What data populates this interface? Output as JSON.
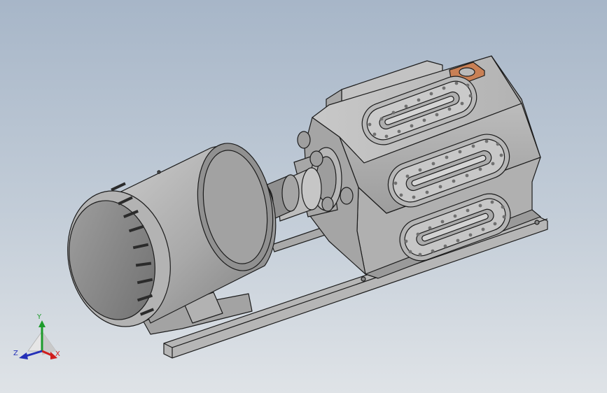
{
  "viewport": {
    "title": "",
    "background_top": "#a7b6c8",
    "background_bottom": "#dfe3e7"
  },
  "model": {
    "body_color": "#b9b9b9",
    "edge_color": "#1c1c1c",
    "gasket_color": "#c98055",
    "components": [
      "motor-icon",
      "coupling-icon",
      "pump-housing-icon",
      "inspection-cover-icon",
      "base-rail-icon"
    ]
  },
  "triad": {
    "x_label": "X",
    "y_label": "Y",
    "z_label": "Z",
    "x_color": "#d01c1c",
    "y_color": "#1d9b2b",
    "z_color": "#2430b8"
  }
}
